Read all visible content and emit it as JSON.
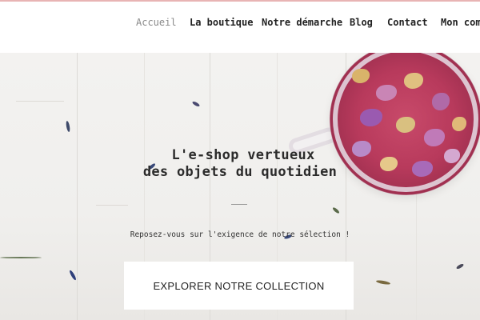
{
  "nav": {
    "items": [
      {
        "label": "Accueil",
        "active": true
      },
      {
        "label": "La boutique"
      },
      {
        "label": "Notre démarche"
      },
      {
        "label": "Blog"
      },
      {
        "label": "Contact"
      },
      {
        "label": "Mon compte"
      }
    ]
  },
  "hero": {
    "title_line1": "L'e-shop vertueux",
    "title_line2": "des objets du quotidien",
    "subtitle": "Reposez-vous sur l'exigence de notre sélection !",
    "cta_label": "EXPLORER NOTRE COLLECTION"
  },
  "colors": {
    "accent_border": "#e8b4b4",
    "tea": "#b83a5c",
    "button_bg": "#ffffff"
  }
}
